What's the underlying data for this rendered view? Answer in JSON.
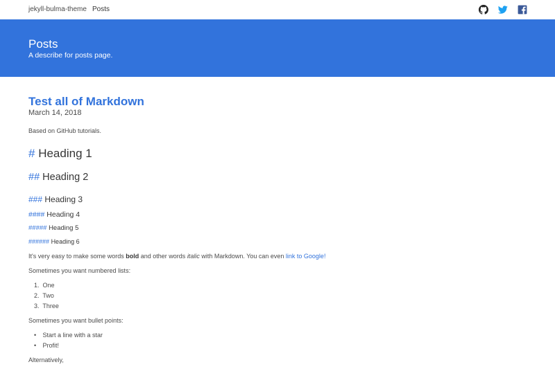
{
  "nav": {
    "brand": "jekyll-bulma-theme",
    "posts": "Posts"
  },
  "icons": {
    "github": "github-icon",
    "twitter": "twitter-icon",
    "facebook": "facebook-icon"
  },
  "colors": {
    "primary": "#3273dc",
    "text": "#4a4a4a",
    "heading": "#363636"
  },
  "hero": {
    "title": "Posts",
    "subtitle": "A describe for posts page."
  },
  "post": {
    "title": "Test all of Markdown",
    "date": "March 14, 2018",
    "intro": "Based on GitHub tutorials.",
    "h1": {
      "hash": "#",
      "text": "Heading 1"
    },
    "h2": {
      "hash": "##",
      "text": "Heading 2"
    },
    "h3": {
      "hash": "###",
      "text": "Heading 3"
    },
    "h4": {
      "hash": "####",
      "text": "Heading 4"
    },
    "h5": {
      "hash": "#####",
      "text": "Heading 5"
    },
    "h6": {
      "hash": "######",
      "text": "Heading 6"
    },
    "para": {
      "a": "It's very easy to make some words ",
      "bold": "bold",
      "b": " and other words ",
      "italic": "italic",
      "c": " with Markdown. You can even ",
      "link": "link to Google!"
    },
    "numbered_intro": "Sometimes you want numbered lists:",
    "numbered": [
      {
        "marker": "1.",
        "text": "One"
      },
      {
        "marker": "2.",
        "text": "Two"
      },
      {
        "marker": "3.",
        "text": "Three"
      }
    ],
    "bullet_intro": "Sometimes you want bullet points:",
    "bullets": [
      {
        "marker": "•",
        "text": "Start a line with a star"
      },
      {
        "marker": "•",
        "text": "Profit!"
      }
    ],
    "alt": "Alternatively,"
  }
}
